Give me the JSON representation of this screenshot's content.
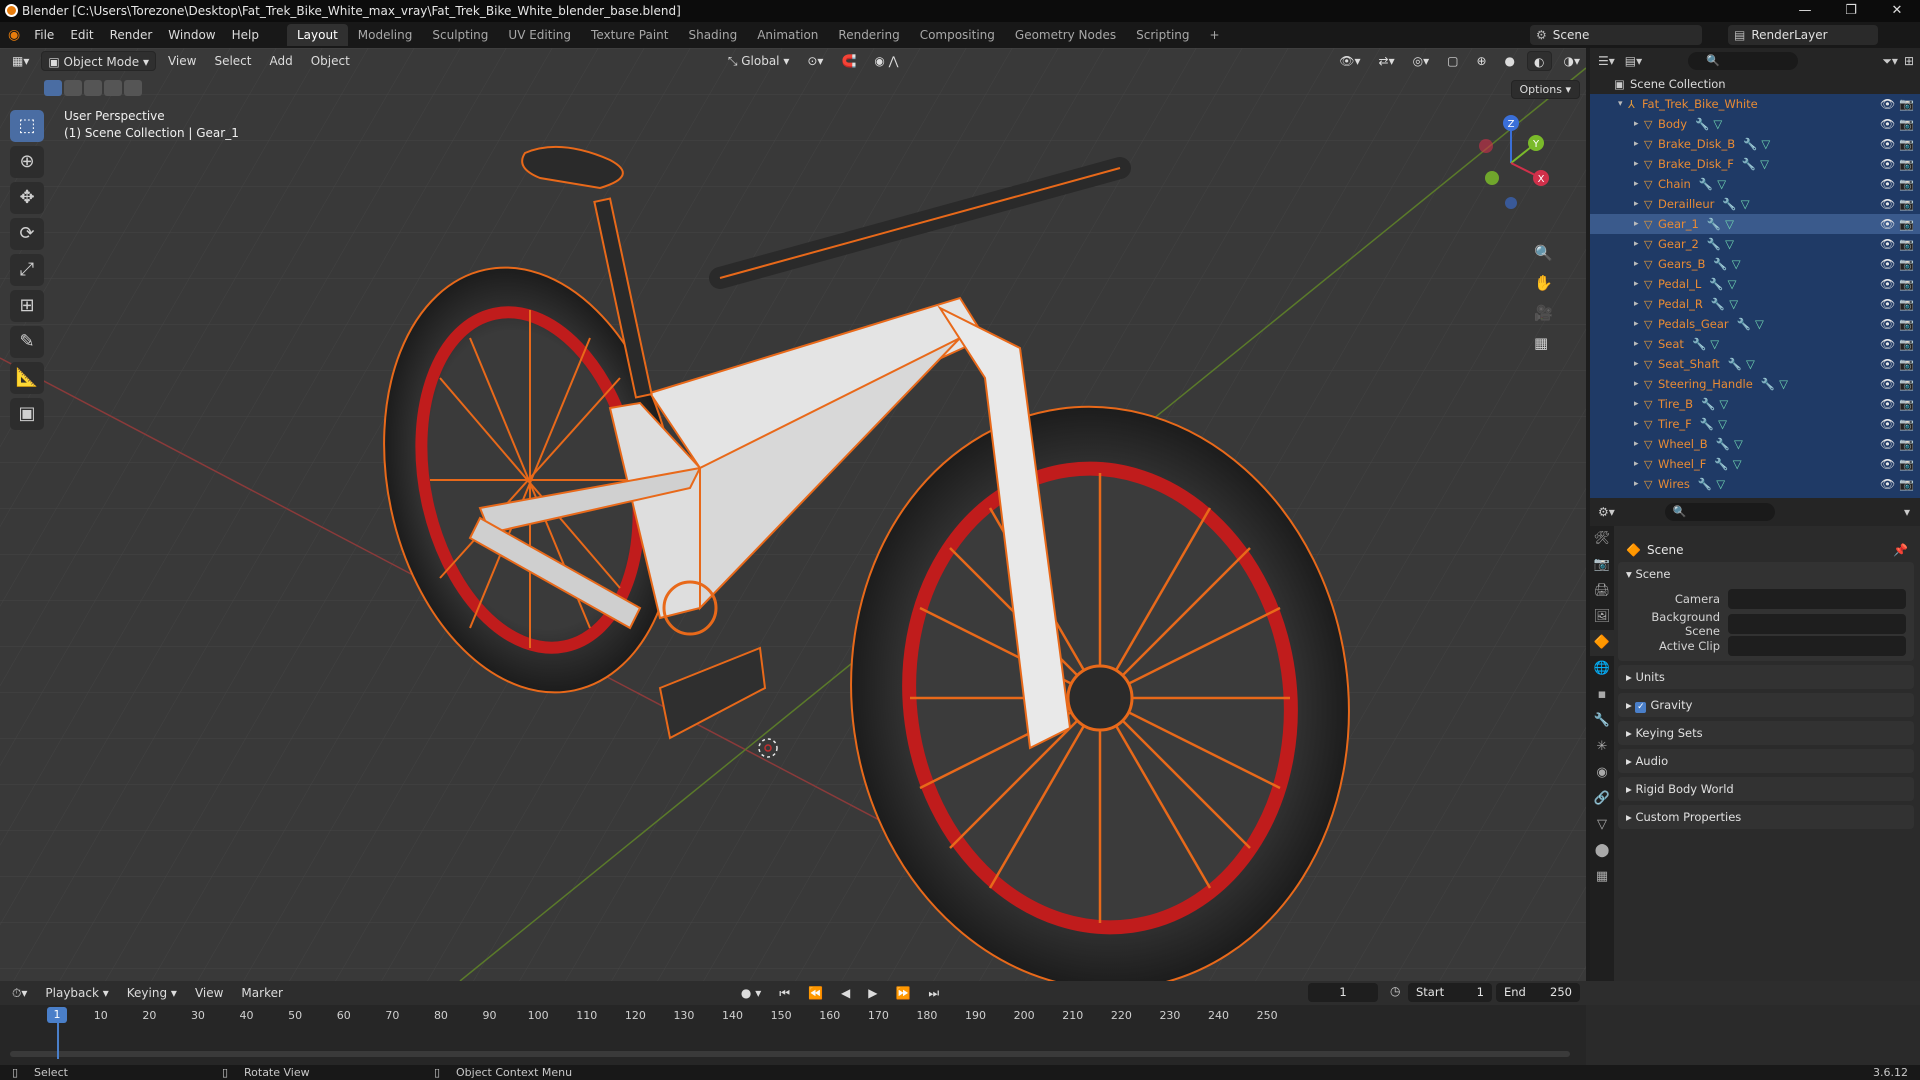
{
  "window": {
    "title": "Blender [C:\\Users\\Torezone\\Desktop\\Fat_Trek_Bike_White_max_vray\\Fat_Trek_Bike_White_blender_base.blend]",
    "controls": [
      "—",
      "❐",
      "✕"
    ]
  },
  "menus": [
    "File",
    "Edit",
    "Render",
    "Window",
    "Help"
  ],
  "workspaces": [
    "Layout",
    "Modeling",
    "Sculpting",
    "UV Editing",
    "Texture Paint",
    "Shading",
    "Animation",
    "Rendering",
    "Compositing",
    "Geometry Nodes",
    "Scripting"
  ],
  "workspace_add": "+",
  "scene_selector": "Scene",
  "view_layer": "RenderLayer",
  "viewport": {
    "mode": "Object Mode",
    "menus": [
      "View",
      "Select",
      "Add",
      "Object"
    ],
    "orientation": "Global",
    "options": "Options",
    "info_line1": "User Perspective",
    "info_line2": "(1) Scene Collection | Gear_1",
    "gizmo_axes": [
      "Z",
      "Y",
      "X"
    ]
  },
  "outliner": {
    "root": "Scene Collection",
    "collection": "Fat_Trek_Bike_White",
    "objects": [
      "Body",
      "Brake_Disk_B",
      "Brake_Disk_F",
      "Chain",
      "Derailleur",
      "Gear_1",
      "Gear_2",
      "Gears_B",
      "Pedal_L",
      "Pedal_R",
      "Pedals_Gear",
      "Seat",
      "Seat_Shaft",
      "Steering_Handle",
      "Tire_B",
      "Tire_F",
      "Wheel_B",
      "Wheel_F",
      "Wires"
    ],
    "selected": "Gear_1"
  },
  "properties": {
    "header": "Scene",
    "panel": "Scene",
    "fields": [
      {
        "label": "Camera"
      },
      {
        "label": "Background Scene"
      },
      {
        "label": "Active Clip"
      }
    ],
    "collapsed_panels": [
      "Units",
      "Gravity",
      "Keying Sets",
      "Audio",
      "Rigid Body World",
      "Custom Properties"
    ],
    "gravity_checked": true
  },
  "timeline": {
    "menus": [
      "Playback",
      "Keying",
      "View",
      "Marker"
    ],
    "current_frame": "1",
    "start_label": "Start",
    "start_value": "1",
    "end_label": "End",
    "end_value": "250",
    "ticks": [
      "10",
      "20",
      "30",
      "40",
      "50",
      "60",
      "70",
      "80",
      "90",
      "100",
      "110",
      "120",
      "130",
      "140",
      "150",
      "160",
      "170",
      "180",
      "190",
      "200",
      "210",
      "220",
      "230",
      "240",
      "250"
    ],
    "playhead": "1"
  },
  "statusbar": {
    "left": "Select",
    "middle": "Rotate View",
    "right": "Object Context Menu",
    "version": "3.6.12"
  },
  "colors": {
    "selection_outline": "#e8691a",
    "rim_red": "#c01c1c",
    "outliner_bg": "#1f3a66",
    "accent_blue": "#4a7fc9"
  }
}
